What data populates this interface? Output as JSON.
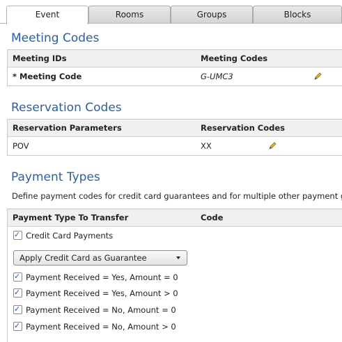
{
  "tabs": [
    "Event",
    "Rooms",
    "Groups",
    "Blocks"
  ],
  "meeting_codes": {
    "title": "Meeting Codes",
    "col1": "Meeting IDs",
    "col2": "Meeting Codes",
    "row_label": "* Meeting Code",
    "row_value": "G-UMC3"
  },
  "reservation_codes": {
    "title": "Reservation Codes",
    "col1": "Reservation Parameters",
    "col2": "Reservation Codes",
    "row_label": "POV",
    "row_value": "XX"
  },
  "payment_types": {
    "title": "Payment Types",
    "description": "Define payment codes for credit card guarantees and for multiple other payment gua",
    "col1": "Payment Type To Transfer",
    "col2": "Code",
    "credit_card_label": "Credit Card Payments",
    "dropdown_value": "Apply Credit Card as Guarantee",
    "options": [
      "Payment Received = Yes, Amount = 0",
      "Payment Received = Yes, Amount > 0",
      "Payment Received = No, Amount = 0",
      "Payment Received = No, Amount > 0"
    ]
  },
  "colors": {
    "heading": "#2f5f9b",
    "check": "#2b5e9e",
    "pencil": "#c9a227"
  },
  "icons": {
    "edit": "pencil-icon",
    "check": "checkmark-icon",
    "dropdown": "triangle-down-icon"
  }
}
